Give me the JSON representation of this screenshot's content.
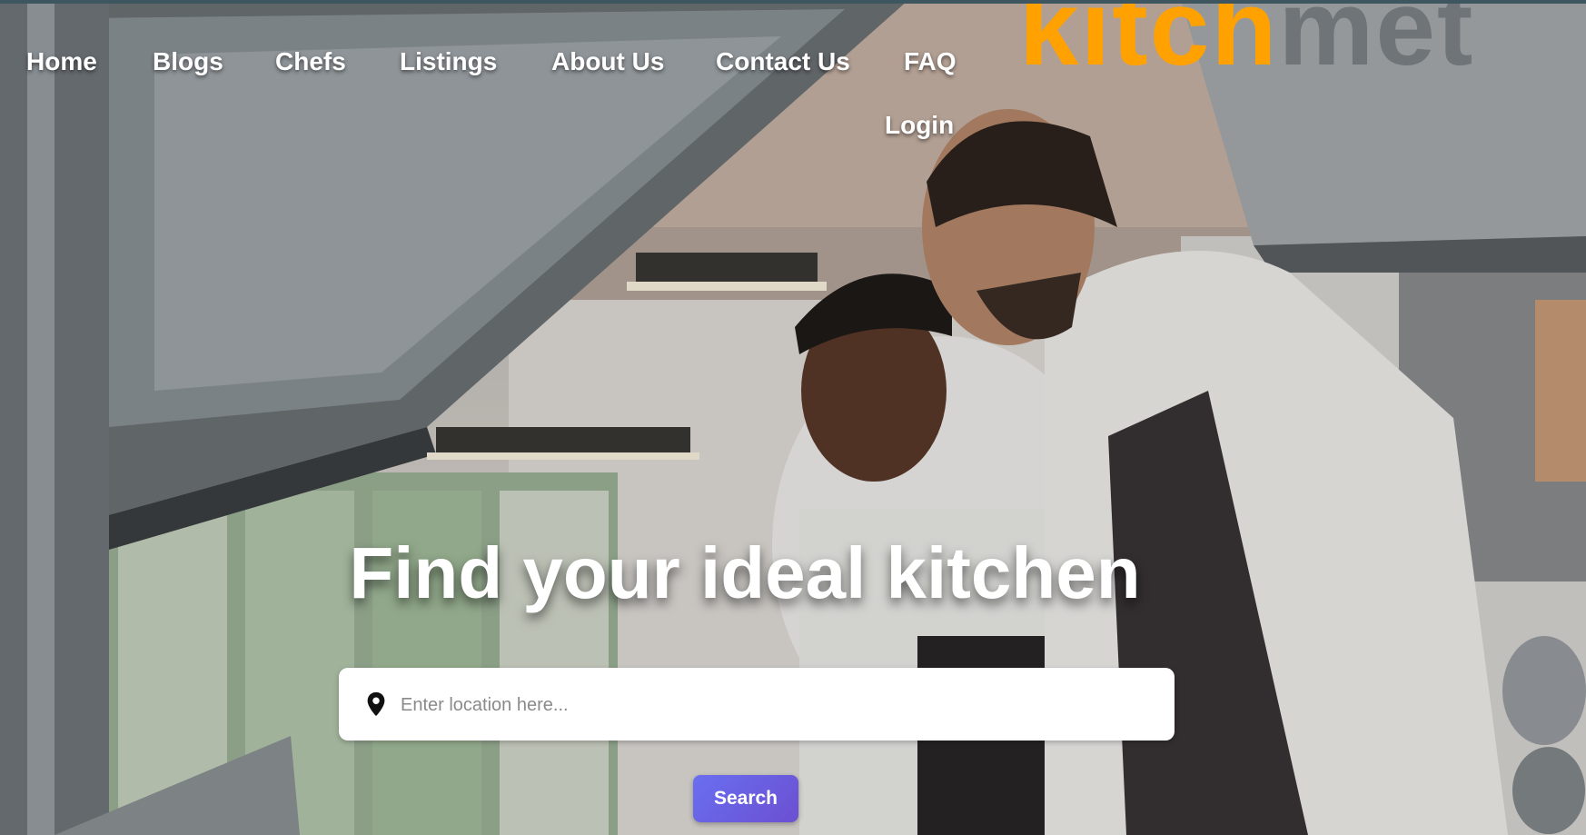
{
  "nav": {
    "items": [
      {
        "label": "Home"
      },
      {
        "label": "Blogs"
      },
      {
        "label": "Chefs"
      },
      {
        "label": "Listings"
      },
      {
        "label": "About Us"
      },
      {
        "label": "Contact Us"
      },
      {
        "label": "FAQ"
      },
      {
        "label": "Login"
      }
    ]
  },
  "logo": {
    "part1": "kitch",
    "part2": "met"
  },
  "hero": {
    "headline": "Find your ideal kitchen"
  },
  "search": {
    "placeholder": "Enter location here...",
    "icon": "map-pin-icon",
    "button_label": "Search"
  },
  "colors": {
    "logo_primary": "#ffa100",
    "logo_secondary": "#6f7478",
    "button": "#6a5fe0",
    "text_on_hero": "#ffffff"
  }
}
